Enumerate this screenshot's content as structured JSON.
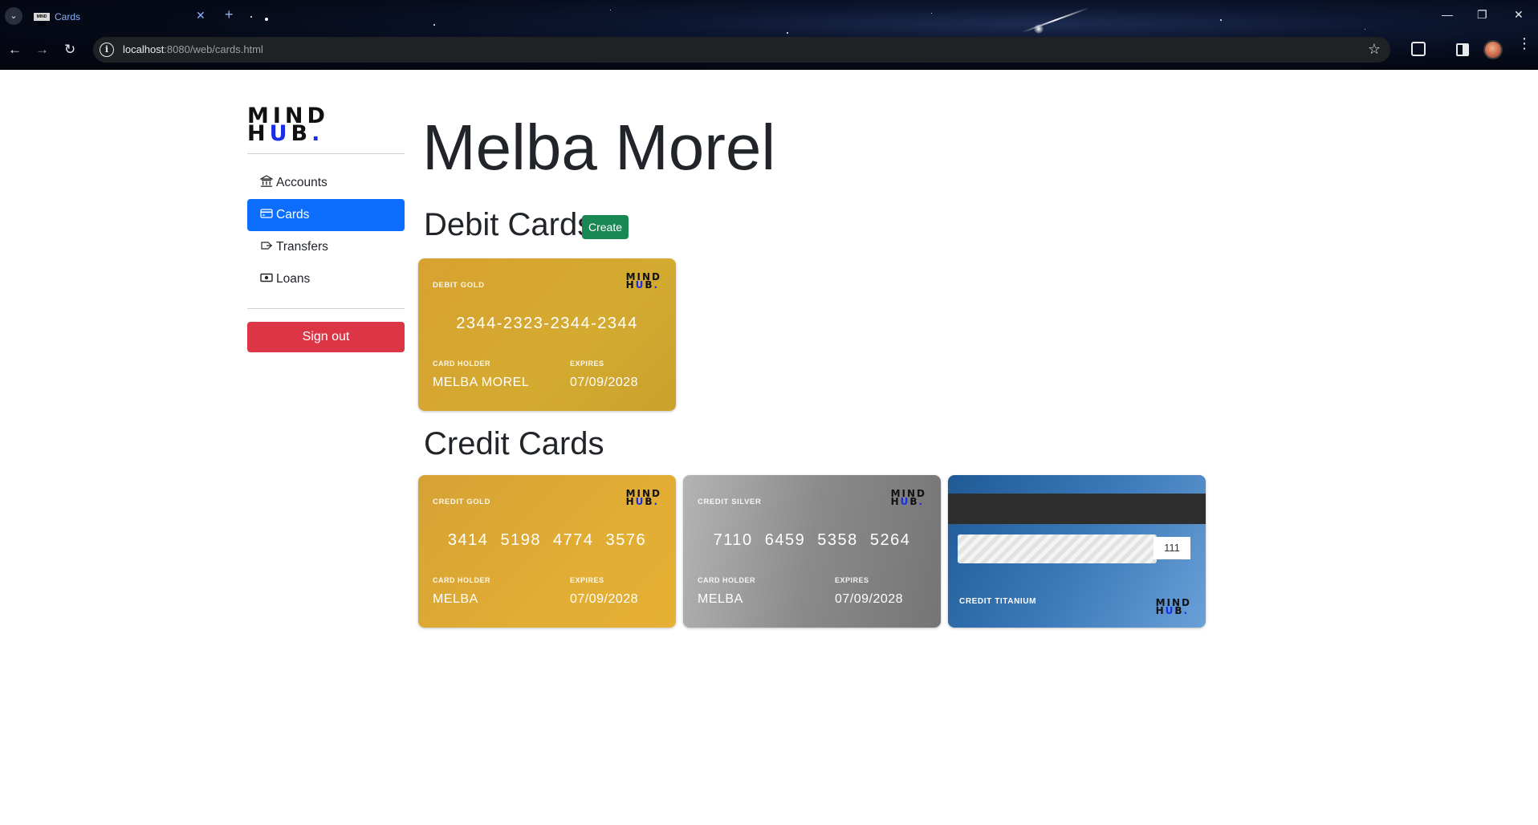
{
  "browser": {
    "tab_title": "Cards",
    "favicon_text": "MIND HUB",
    "url_host": "localhost",
    "url_rest": ":8080/web/cards.html"
  },
  "sidebar": {
    "logo_line1": "MIND",
    "logo_line2_a": "H",
    "logo_line2_b": "U",
    "logo_line2_c": "B",
    "logo_dot": ".",
    "items": [
      {
        "label": "Accounts",
        "icon": "bank-icon"
      },
      {
        "label": "Cards",
        "icon": "credit-card-icon",
        "active": true
      },
      {
        "label": "Transfers",
        "icon": "transfer-icon"
      },
      {
        "label": "Loans",
        "icon": "cash-icon"
      }
    ],
    "signout_label": "Sign out"
  },
  "main": {
    "client_name": "Melba Morel",
    "debit_title": "Debit Cards",
    "create_label": "Create",
    "credit_title": "Credit Cards",
    "card_holder_label": "CARD HOLDER",
    "expires_label": "EXPIRES",
    "debit_cards": [
      {
        "type": "DEBIT GOLD",
        "number": "2344-2323-2344-2344",
        "holder": "MELBA MOREL",
        "expires": "07/09/2028",
        "color": "#d4aa30"
      }
    ],
    "credit_cards": [
      {
        "type": "CREDIT GOLD",
        "number": "3414 5198 4774 3576",
        "holder": "MELBA",
        "expires": "07/09/2028",
        "color": "#e1ad34"
      },
      {
        "type": "CREDIT SILVER",
        "number": "7110 6459 5358 5264",
        "holder": "MELBA",
        "expires": "07/09/2028",
        "color": "#8a8a8a"
      },
      {
        "type": "CREDIT TITANIUM",
        "cvv": "111",
        "color": "#3a78b8"
      }
    ]
  },
  "colors": {
    "primary": "#0d6efd",
    "danger": "#dc3545",
    "success": "#198754"
  }
}
